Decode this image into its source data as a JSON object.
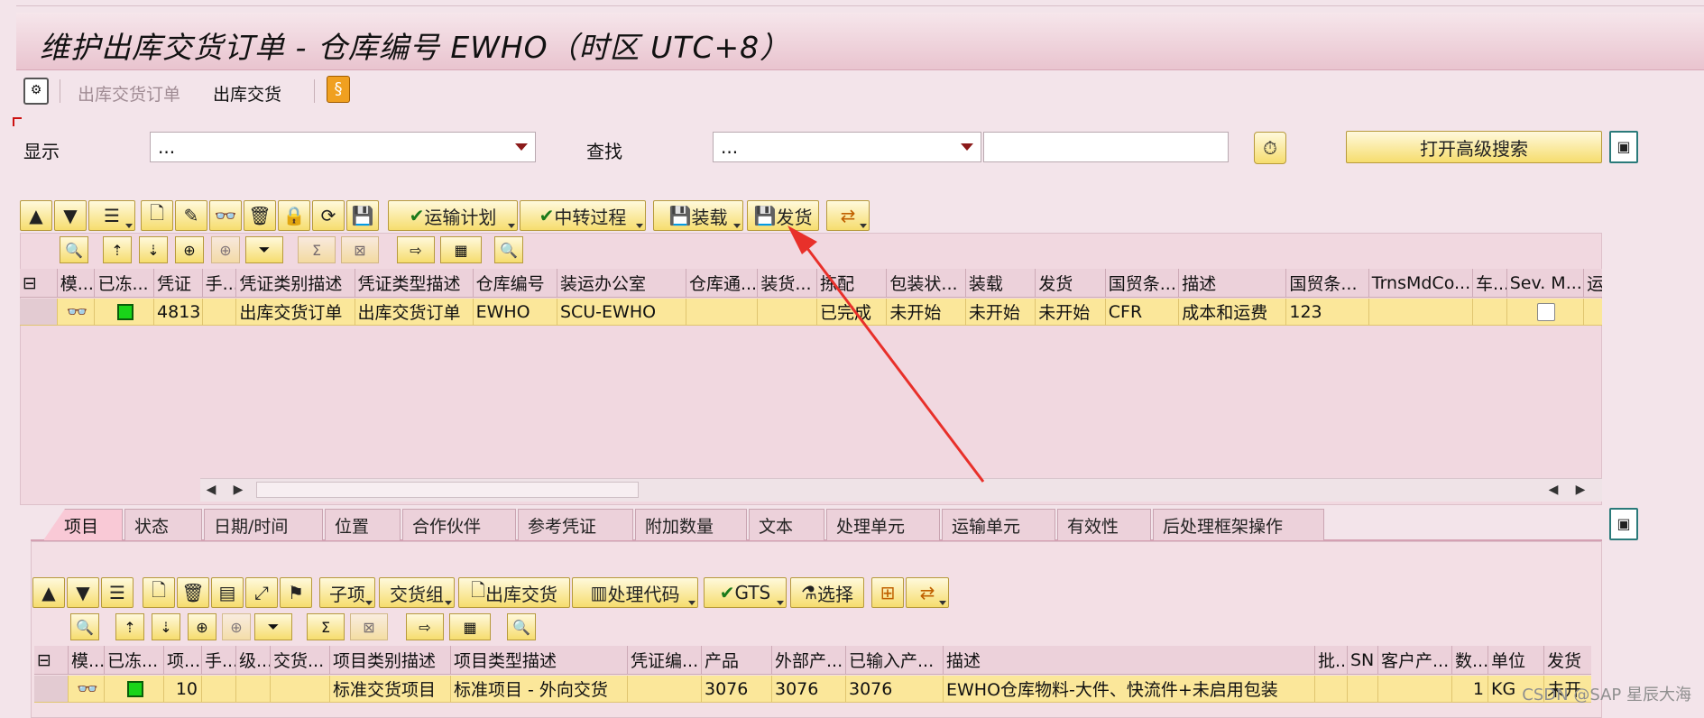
{
  "window": {
    "title": "维护出库交货订单 - 仓库编号 EWHO（时区 UTC+8）"
  },
  "menu": {
    "item1": "出库交货订单",
    "item2": "出库交货"
  },
  "filters": {
    "display_label": "显示",
    "display_value": "...",
    "find_label": "查找",
    "find_value": "...",
    "find_text": "",
    "advanced_search": "打开高级搜索"
  },
  "toolbar1": {
    "transport_plan": "运输计划",
    "transfer": "中转过程",
    "load": "装载",
    "ship": "发货"
  },
  "grid1": {
    "headers": [
      "模...",
      "已冻...",
      "凭证",
      "手...",
      "凭证类别描述",
      "凭证类型描述",
      "仓库编号",
      "装运办公室",
      "仓库通...",
      "装货...",
      "拣配",
      "包装状...",
      "装载",
      "发货",
      "国贸条...",
      "描述",
      "国贸条...",
      "TrnsMdCo...",
      "车...",
      "Sev. M...",
      "运"
    ],
    "row": [
      "",
      "",
      "4813",
      "",
      "出库交货订单",
      "出库交货订单",
      "EWHO",
      "SCU-EWHO",
      "",
      "",
      "已完成",
      "未开始",
      "未开始",
      "未开始",
      "CFR",
      "成本和运费",
      "123",
      "",
      "",
      "",
      ""
    ]
  },
  "tabs": [
    "项目",
    "状态",
    "日期/时间",
    "位置",
    "合作伙伴",
    "参考凭证",
    "附加数量",
    "文本",
    "处理单元",
    "运输单元",
    "有效性",
    "后处理框架操作"
  ],
  "toolbar2": {
    "subitem": "子项",
    "delivery_group": "交货组",
    "outbound": "出库交货",
    "proc_code": "处理代码",
    "gts": "GTS",
    "select": "选择"
  },
  "grid2": {
    "headers": [
      "模...",
      "已冻...",
      "项...",
      "手...",
      "级...",
      "交货...",
      "项目类别描述",
      "项目类型描述",
      "凭证编...",
      "产品",
      "外部产...",
      "已输入产...",
      "描述",
      "批...",
      "SN",
      "客户产...",
      "数...",
      "单位",
      "发货"
    ],
    "row": [
      "",
      "",
      "10",
      "",
      "",
      "",
      "标准交货项目",
      "标准项目 - 外向交货",
      "",
      "3076",
      "3076",
      "3076",
      "EWHO仓库物料-大件、快流件+未启用包装",
      "",
      "",
      "",
      "1",
      "KG",
      "未开"
    ]
  },
  "watermark": "CSDN @SAP 星辰大海",
  "colors": {
    "title_bg": "#e9c4cf",
    "button": "#f6dd6e",
    "row_highlight": "#fbe79a",
    "arrow": "#e8302a",
    "status_green": "#19d419"
  }
}
